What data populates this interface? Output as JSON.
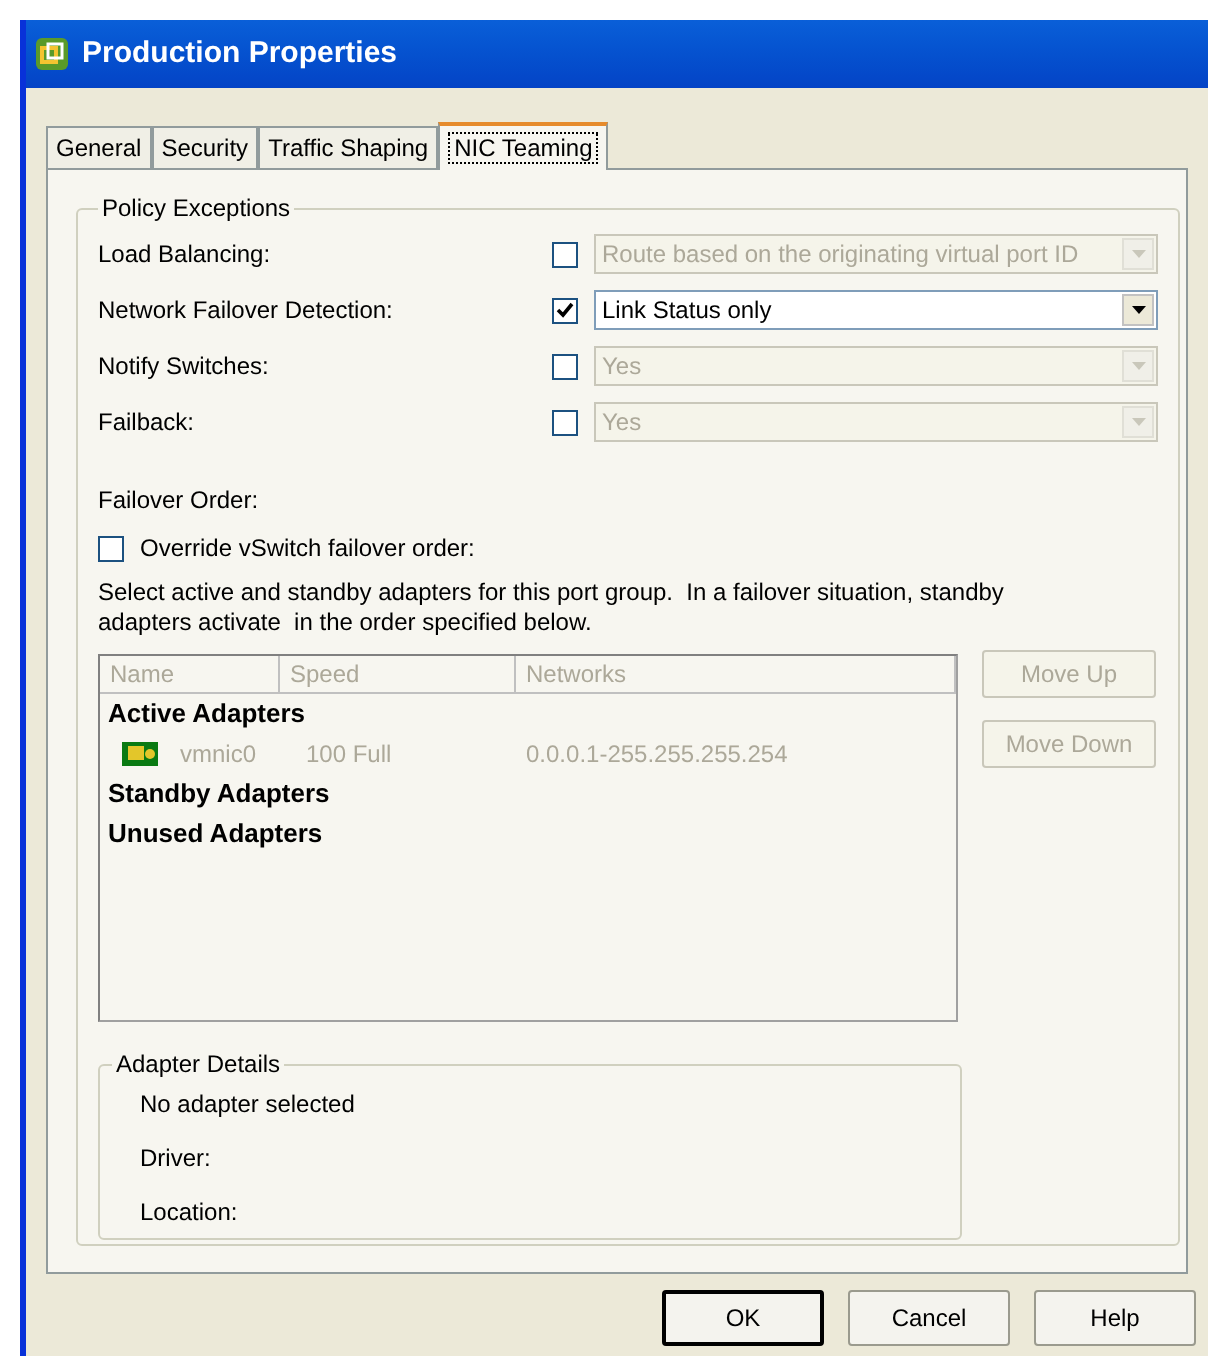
{
  "window": {
    "title": "Production Properties"
  },
  "tabs": [
    {
      "label": "General",
      "selected": false
    },
    {
      "label": "Security",
      "selected": false
    },
    {
      "label": "Traffic Shaping",
      "selected": false
    },
    {
      "label": "NIC Teaming",
      "selected": true
    }
  ],
  "policy_exceptions": {
    "title": "Policy Exceptions",
    "rows": [
      {
        "label": "Load Balancing:",
        "checked": false,
        "value": "Route based on the originating virtual port ID",
        "disabled": true
      },
      {
        "label": "Network Failover Detection:",
        "checked": true,
        "value": "Link Status only",
        "disabled": false
      },
      {
        "label": "Notify Switches:",
        "checked": false,
        "value": "Yes",
        "disabled": true
      },
      {
        "label": "Failback:",
        "checked": false,
        "value": "Yes",
        "disabled": true
      }
    ]
  },
  "failover_order": {
    "label": "Failover Order:",
    "override": {
      "label": "Override vSwitch failover order:",
      "checked": false
    },
    "description": "Select active and standby adapters for this port group.  In a failover situation, standby adapters activate  in the order specified below.",
    "table": {
      "columns": [
        "Name",
        "Speed",
        "Networks"
      ],
      "groups": [
        {
          "title": "Active Adapters",
          "rows": [
            {
              "name": "vmnic0",
              "speed": "100 Full",
              "networks": "0.0.0.1-255.255.255.254"
            }
          ]
        },
        {
          "title": "Standby Adapters"
        },
        {
          "title": "Unused Adapters"
        }
      ]
    },
    "buttons": [
      {
        "label": "Move Up",
        "disabled": true
      },
      {
        "label": "Move Down",
        "disabled": true
      }
    ]
  },
  "adapter_details": {
    "title": "Adapter Details",
    "lines": [
      "No adapter selected",
      "Driver:",
      "Location:"
    ]
  },
  "buttons": [
    {
      "label": "OK",
      "default": true
    },
    {
      "label": "Cancel",
      "default": false
    },
    {
      "label": "Help",
      "default": false
    }
  ]
}
